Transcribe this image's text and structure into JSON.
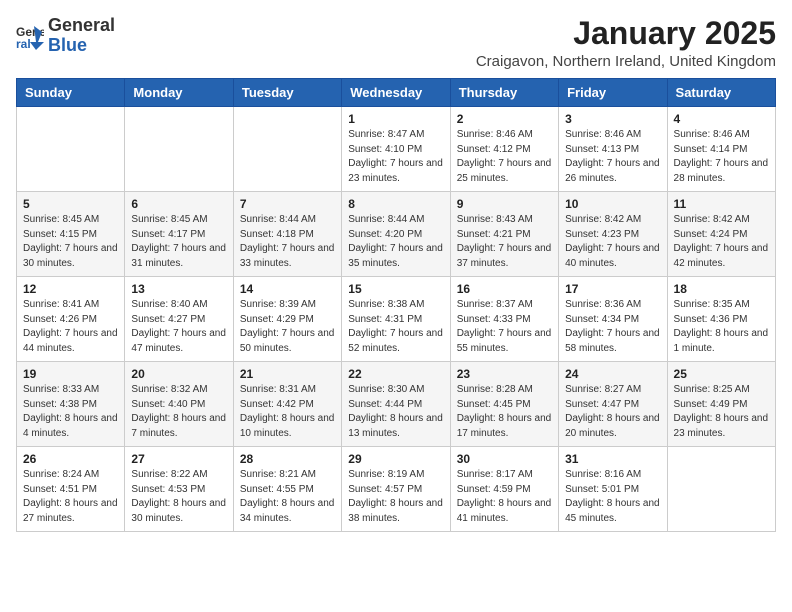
{
  "logo": {
    "general": "General",
    "blue": "Blue"
  },
  "header": {
    "month_year": "January 2025",
    "location": "Craigavon, Northern Ireland, United Kingdom"
  },
  "days_of_week": [
    "Sunday",
    "Monday",
    "Tuesday",
    "Wednesday",
    "Thursday",
    "Friday",
    "Saturday"
  ],
  "weeks": [
    [
      {
        "day": "",
        "content": ""
      },
      {
        "day": "",
        "content": ""
      },
      {
        "day": "",
        "content": ""
      },
      {
        "day": "1",
        "content": "Sunrise: 8:47 AM\nSunset: 4:10 PM\nDaylight: 7 hours and 23 minutes."
      },
      {
        "day": "2",
        "content": "Sunrise: 8:46 AM\nSunset: 4:12 PM\nDaylight: 7 hours and 25 minutes."
      },
      {
        "day": "3",
        "content": "Sunrise: 8:46 AM\nSunset: 4:13 PM\nDaylight: 7 hours and 26 minutes."
      },
      {
        "day": "4",
        "content": "Sunrise: 8:46 AM\nSunset: 4:14 PM\nDaylight: 7 hours and 28 minutes."
      }
    ],
    [
      {
        "day": "5",
        "content": "Sunrise: 8:45 AM\nSunset: 4:15 PM\nDaylight: 7 hours and 30 minutes."
      },
      {
        "day": "6",
        "content": "Sunrise: 8:45 AM\nSunset: 4:17 PM\nDaylight: 7 hours and 31 minutes."
      },
      {
        "day": "7",
        "content": "Sunrise: 8:44 AM\nSunset: 4:18 PM\nDaylight: 7 hours and 33 minutes."
      },
      {
        "day": "8",
        "content": "Sunrise: 8:44 AM\nSunset: 4:20 PM\nDaylight: 7 hours and 35 minutes."
      },
      {
        "day": "9",
        "content": "Sunrise: 8:43 AM\nSunset: 4:21 PM\nDaylight: 7 hours and 37 minutes."
      },
      {
        "day": "10",
        "content": "Sunrise: 8:42 AM\nSunset: 4:23 PM\nDaylight: 7 hours and 40 minutes."
      },
      {
        "day": "11",
        "content": "Sunrise: 8:42 AM\nSunset: 4:24 PM\nDaylight: 7 hours and 42 minutes."
      }
    ],
    [
      {
        "day": "12",
        "content": "Sunrise: 8:41 AM\nSunset: 4:26 PM\nDaylight: 7 hours and 44 minutes."
      },
      {
        "day": "13",
        "content": "Sunrise: 8:40 AM\nSunset: 4:27 PM\nDaylight: 7 hours and 47 minutes."
      },
      {
        "day": "14",
        "content": "Sunrise: 8:39 AM\nSunset: 4:29 PM\nDaylight: 7 hours and 50 minutes."
      },
      {
        "day": "15",
        "content": "Sunrise: 8:38 AM\nSunset: 4:31 PM\nDaylight: 7 hours and 52 minutes."
      },
      {
        "day": "16",
        "content": "Sunrise: 8:37 AM\nSunset: 4:33 PM\nDaylight: 7 hours and 55 minutes."
      },
      {
        "day": "17",
        "content": "Sunrise: 8:36 AM\nSunset: 4:34 PM\nDaylight: 7 hours and 58 minutes."
      },
      {
        "day": "18",
        "content": "Sunrise: 8:35 AM\nSunset: 4:36 PM\nDaylight: 8 hours and 1 minute."
      }
    ],
    [
      {
        "day": "19",
        "content": "Sunrise: 8:33 AM\nSunset: 4:38 PM\nDaylight: 8 hours and 4 minutes."
      },
      {
        "day": "20",
        "content": "Sunrise: 8:32 AM\nSunset: 4:40 PM\nDaylight: 8 hours and 7 minutes."
      },
      {
        "day": "21",
        "content": "Sunrise: 8:31 AM\nSunset: 4:42 PM\nDaylight: 8 hours and 10 minutes."
      },
      {
        "day": "22",
        "content": "Sunrise: 8:30 AM\nSunset: 4:44 PM\nDaylight: 8 hours and 13 minutes."
      },
      {
        "day": "23",
        "content": "Sunrise: 8:28 AM\nSunset: 4:45 PM\nDaylight: 8 hours and 17 minutes."
      },
      {
        "day": "24",
        "content": "Sunrise: 8:27 AM\nSunset: 4:47 PM\nDaylight: 8 hours and 20 minutes."
      },
      {
        "day": "25",
        "content": "Sunrise: 8:25 AM\nSunset: 4:49 PM\nDaylight: 8 hours and 23 minutes."
      }
    ],
    [
      {
        "day": "26",
        "content": "Sunrise: 8:24 AM\nSunset: 4:51 PM\nDaylight: 8 hours and 27 minutes."
      },
      {
        "day": "27",
        "content": "Sunrise: 8:22 AM\nSunset: 4:53 PM\nDaylight: 8 hours and 30 minutes."
      },
      {
        "day": "28",
        "content": "Sunrise: 8:21 AM\nSunset: 4:55 PM\nDaylight: 8 hours and 34 minutes."
      },
      {
        "day": "29",
        "content": "Sunrise: 8:19 AM\nSunset: 4:57 PM\nDaylight: 8 hours and 38 minutes."
      },
      {
        "day": "30",
        "content": "Sunrise: 8:17 AM\nSunset: 4:59 PM\nDaylight: 8 hours and 41 minutes."
      },
      {
        "day": "31",
        "content": "Sunrise: 8:16 AM\nSunset: 5:01 PM\nDaylight: 8 hours and 45 minutes."
      },
      {
        "day": "",
        "content": ""
      }
    ]
  ]
}
